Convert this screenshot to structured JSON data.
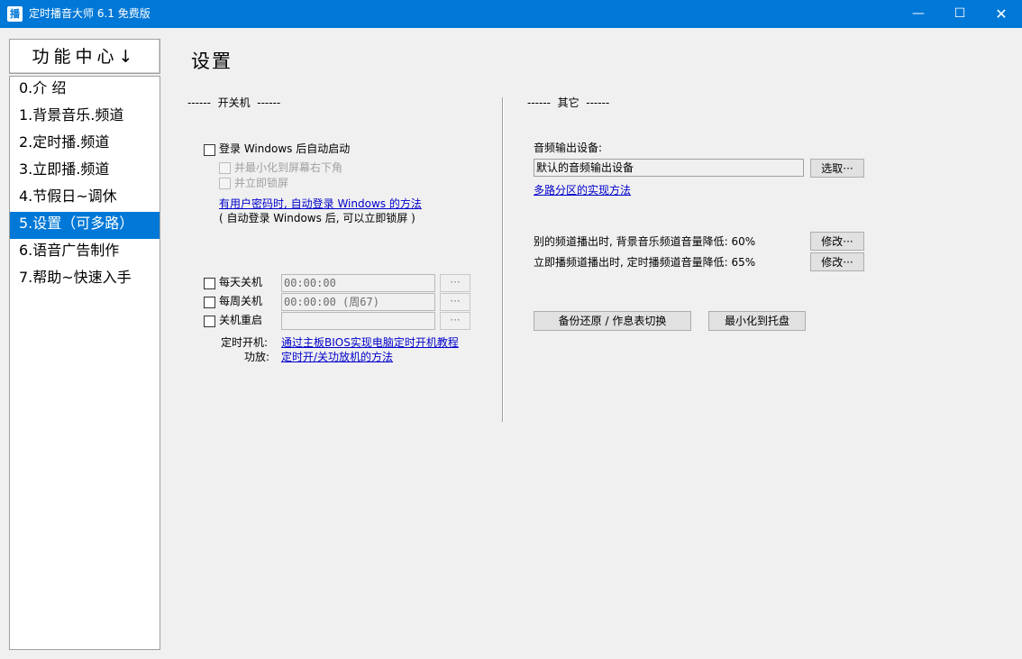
{
  "window": {
    "title": "定时播音大师 6.1 免费版",
    "app_icon_glyph": "播",
    "minimize_glyph": "—",
    "maximize_glyph": "☐",
    "close_glyph": "✕",
    "accent_color": "#0078d7"
  },
  "sidebar": {
    "header": "功能中心↓",
    "items": [
      {
        "label": "0.介 绍"
      },
      {
        "label": "1.背景音乐.频道"
      },
      {
        "label": "2.定时播.频道"
      },
      {
        "label": "3.立即播.频道"
      },
      {
        "label": "4.节假日~调休"
      },
      {
        "label": "5.设置（可多路）",
        "selected": true
      },
      {
        "label": "6.语音广告制作"
      },
      {
        "label": "7.帮助~快速入手"
      }
    ]
  },
  "main": {
    "title": "设置",
    "power_group": {
      "label": "------  开关机  ------",
      "autostart_label": "登录 Windows 后自动启动",
      "minimize_label": "并最小化到屏幕右下角",
      "lock_label": "并立即锁屏",
      "autologin_link": "有用户密码时, 自动登录 Windows 的方法",
      "autologin_note": "( 自动登录 Windows 后, 可以立即锁屏 )",
      "daily_off_label": "每天关机",
      "daily_off_value": "00:00:00",
      "weekly_off_label": "每周关机",
      "weekly_off_value": "00:00:00 (周67)",
      "restart_label": "关机重启",
      "restart_value": "",
      "dots_label": "···",
      "timed_on_label": "定时开机:",
      "timed_on_link": "通过主板BIOS实现电脑定时开机教程",
      "amp_label": "功放:",
      "amp_link": "定时开/关功放机的方法"
    },
    "other_group": {
      "label": "------  其它  ------",
      "audio_device_label": "音频输出设备:",
      "audio_device_value": "默认的音频输出设备",
      "select_button": "选取···",
      "multi_zone_link": "多路分区的实现方法",
      "bg_reduce_text": "别的频道播出时, 背景音乐频道音量降低: 60%",
      "timed_reduce_text": "立即播频道播出时, 定时播频道音量降低: 65%",
      "modify_button": "修改···",
      "backup_button": "备份还原 / 作息表切换",
      "tray_button": "最小化到托盘"
    }
  }
}
